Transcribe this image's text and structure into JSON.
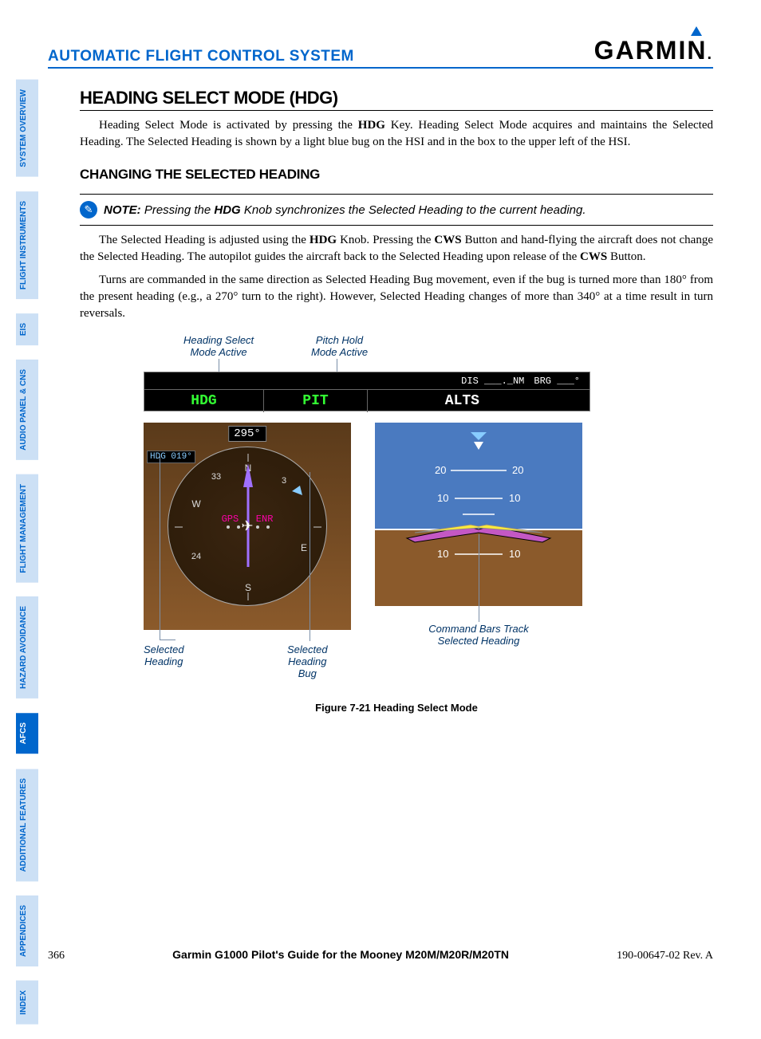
{
  "header": {
    "section_title": "AUTOMATIC FLIGHT CONTROL SYSTEM",
    "brand": "GARMIN"
  },
  "sidebar": {
    "tabs": [
      {
        "label": "SYSTEM OVERVIEW",
        "active": false
      },
      {
        "label": "FLIGHT INSTRUMENTS",
        "active": false
      },
      {
        "label": "EIS",
        "active": false
      },
      {
        "label": "AUDIO PANEL & CNS",
        "active": false
      },
      {
        "label": "FLIGHT MANAGEMENT",
        "active": false
      },
      {
        "label": "HAZARD AVOIDANCE",
        "active": false
      },
      {
        "label": "AFCS",
        "active": true
      },
      {
        "label": "ADDITIONAL FEATURES",
        "active": false
      },
      {
        "label": "APPENDICES",
        "active": false
      },
      {
        "label": "INDEX",
        "active": false
      }
    ]
  },
  "content": {
    "h2": "HEADING SELECT MODE (HDG)",
    "p1_a": "Heading Select Mode is activated by pressing the ",
    "p1_hdg": "HDG",
    "p1_b": " Key.  Heading Select Mode acquires and maintains the Selected Heading.  The Selected Heading is shown by a light blue bug on the HSI and in the box to the upper left of the HSI.",
    "h3": "CHANGING THE SELECTED HEADING",
    "note_label": "NOTE:",
    "note_a": " Pressing the ",
    "note_hdg": "HDG",
    "note_b": " Knob synchronizes the Selected Heading to the current heading.",
    "p2_a": "The Selected Heading is adjusted using the ",
    "p2_hdg": "HDG",
    "p2_b": " Knob.  Pressing the ",
    "p2_cws": "CWS",
    "p2_c": " Button and hand-flying the aircraft does not change the Selected Heading.  The autopilot guides the aircraft back to the Selected Heading upon release of the ",
    "p2_cws2": "CWS",
    "p2_d": " Button.",
    "p3": "Turns are commanded in the same direction as Selected Heading Bug movement, even if the bug is turned more than 180° from the present heading (e.g., a 270° turn to the right).  However, Selected Heading changes of more than 340° at a time result in turn reversals."
  },
  "figure": {
    "callout_hdg_mode": "Heading Select\nMode Active",
    "callout_pit_mode": "Pitch Hold\nMode Active",
    "mode_bar": {
      "dis": "DIS ___._NM",
      "brg": "BRG ___°",
      "hdg": "HDG",
      "pit": "PIT",
      "alts": "ALTS"
    },
    "hsi": {
      "hdg_box": "HDG  019°",
      "lubber": "295°",
      "gps": "GPS",
      "enr": "ENR"
    },
    "adi": {
      "tick20": "20",
      "tick10": "10"
    },
    "callout_sel_hdg": "Selected\nHeading",
    "callout_sel_bug": "Selected\nHeading\nBug",
    "callout_cmd_bars": "Command Bars Track\nSelected Heading",
    "caption": "Figure 7-21  Heading Select Mode"
  },
  "footer": {
    "page": "366",
    "guide": "Garmin G1000 Pilot's Guide for the Mooney M20M/M20R/M20TN",
    "rev": "190-00647-02  Rev. A"
  }
}
